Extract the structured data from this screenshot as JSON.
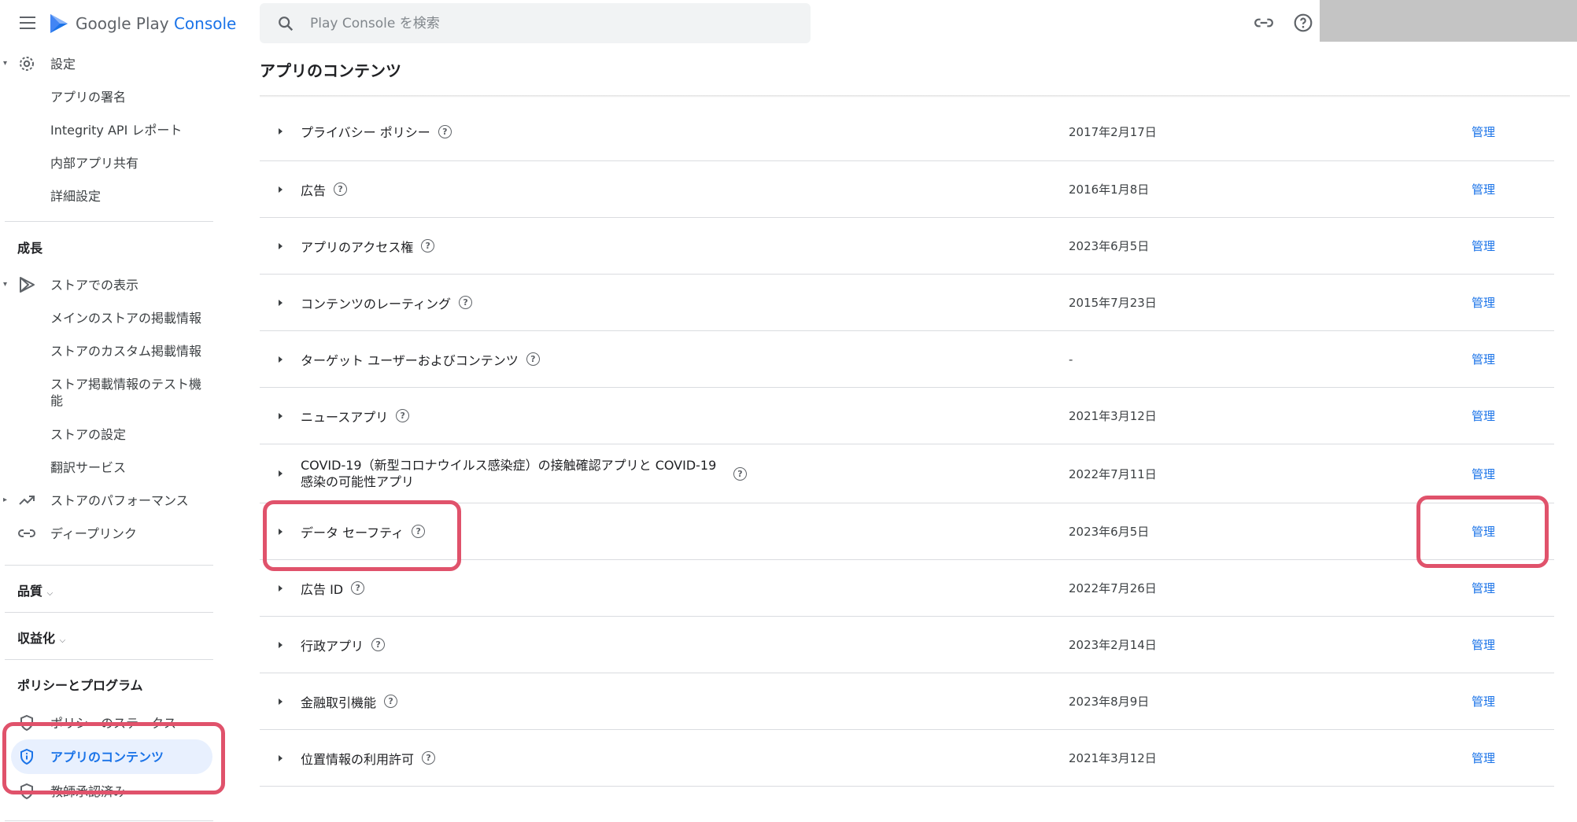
{
  "header": {
    "logo_text_main": "Google Play ",
    "logo_text_accent": "Console",
    "search_placeholder": "Play Console を検索",
    "page_title": "アプリのコンテンツ"
  },
  "sidebar": {
    "settings": "設定",
    "settings_items": [
      "アプリの署名",
      "Integrity API レポート",
      "内部アプリ共有",
      "詳細設定"
    ],
    "growth_head": "成長",
    "store_presence": "ストアでの表示",
    "store_items": [
      "メインのストアの掲載情報",
      "ストアのカスタム掲載情報",
      "ストア掲載情報のテスト機能",
      "ストアの設定",
      "翻訳サービス"
    ],
    "store_performance": "ストアのパフォーマンス",
    "deep_links": "ディープリンク",
    "quality_head": "品質",
    "monetize_head": "収益化",
    "policy_head": "ポリシーとプログラム",
    "policy_status": "ポリシーのステータス",
    "app_content": "アプリのコンテンツ",
    "teacher_approved": "教師承認済み"
  },
  "rows": [
    {
      "name": "プライバシー ポリシー",
      "date": "2017年2月17日",
      "action": "管理"
    },
    {
      "name": "広告",
      "date": "2016年1月8日",
      "action": "管理"
    },
    {
      "name": "アプリのアクセス権",
      "date": "2023年6月5日",
      "action": "管理"
    },
    {
      "name": "コンテンツのレーティング",
      "date": "2015年7月23日",
      "action": "管理"
    },
    {
      "name": "ターゲット ユーザーおよびコンテンツ",
      "date": "-",
      "action": "管理"
    },
    {
      "name": "ニュースアプリ",
      "date": "2021年3月12日",
      "action": "管理"
    },
    {
      "name": "COVID-19（新型コロナウイルス感染症）の接触確認アプリと COVID-19 感染の可能性アプリ",
      "date": "2022年7月11日",
      "action": "管理"
    },
    {
      "name": "データ セーフティ",
      "date": "2023年6月5日",
      "action": "管理"
    },
    {
      "name": "広告 ID",
      "date": "2022年7月26日",
      "action": "管理"
    },
    {
      "name": "行政アプリ",
      "date": "2023年2月14日",
      "action": "管理"
    },
    {
      "name": "金融取引機能",
      "date": "2023年8月9日",
      "action": "管理"
    },
    {
      "name": "位置情報の利用許可",
      "date": "2021年3月12日",
      "action": "管理"
    }
  ],
  "colors": {
    "accent": "#1a73e8",
    "highlight": "#e0526b"
  }
}
